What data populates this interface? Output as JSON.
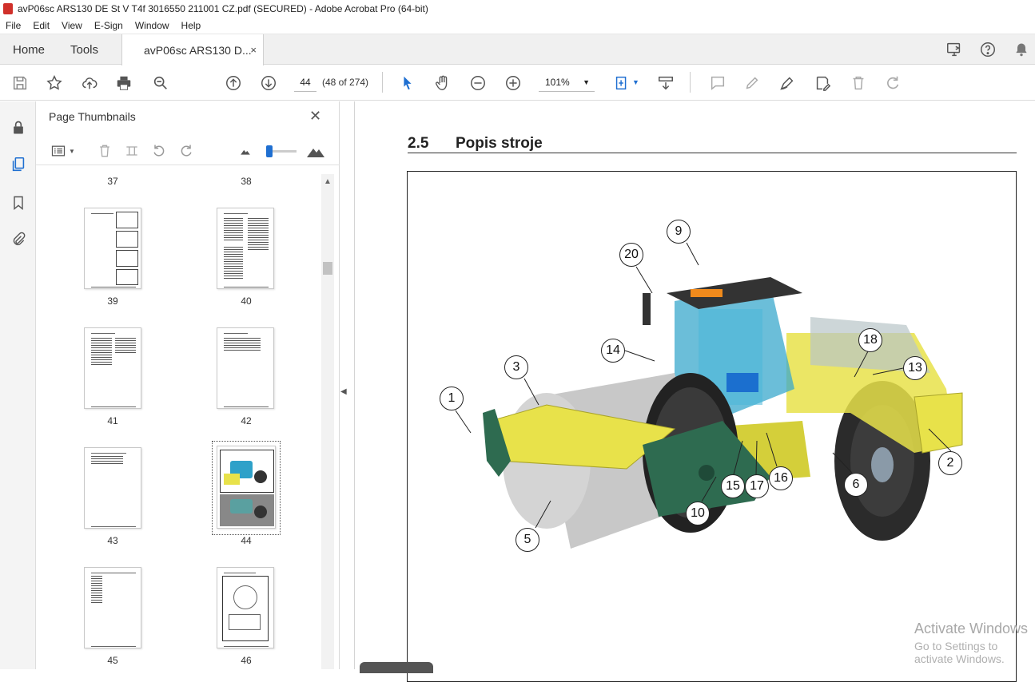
{
  "window": {
    "title": "avP06sc ARS130 DE St V T4f 3016550 211001 CZ.pdf (SECURED) - Adobe Acrobat Pro (64-bit)"
  },
  "menu": [
    "File",
    "Edit",
    "View",
    "E-Sign",
    "Window",
    "Help"
  ],
  "tabs": {
    "home": "Home",
    "tools": "Tools",
    "document": "avP06sc ARS130 D...",
    "close": "×"
  },
  "toolbar": {
    "page_number": "44",
    "page_count": "(48 of 274)",
    "zoom": "101%"
  },
  "thumbnails": {
    "title": "Page Thumbnails",
    "close": "✕",
    "labels": [
      "37",
      "38",
      "39",
      "40",
      "41",
      "42",
      "43",
      "44",
      "45",
      "46"
    ],
    "selected_page": "44"
  },
  "document": {
    "section_number": "2.5",
    "section_title": "Popis stroje",
    "callouts": [
      "1",
      "2",
      "3",
      "5",
      "6",
      "9",
      "10",
      "13",
      "14",
      "15",
      "16",
      "17",
      "18",
      "20"
    ]
  },
  "watermark": {
    "line1": "Activate Windows",
    "line2": "Go to Settings to activate Windows."
  },
  "colors": {
    "accent": "#1f6fd1",
    "machine_yellow": "#e8e24a",
    "machine_green": "#2e6b50"
  }
}
